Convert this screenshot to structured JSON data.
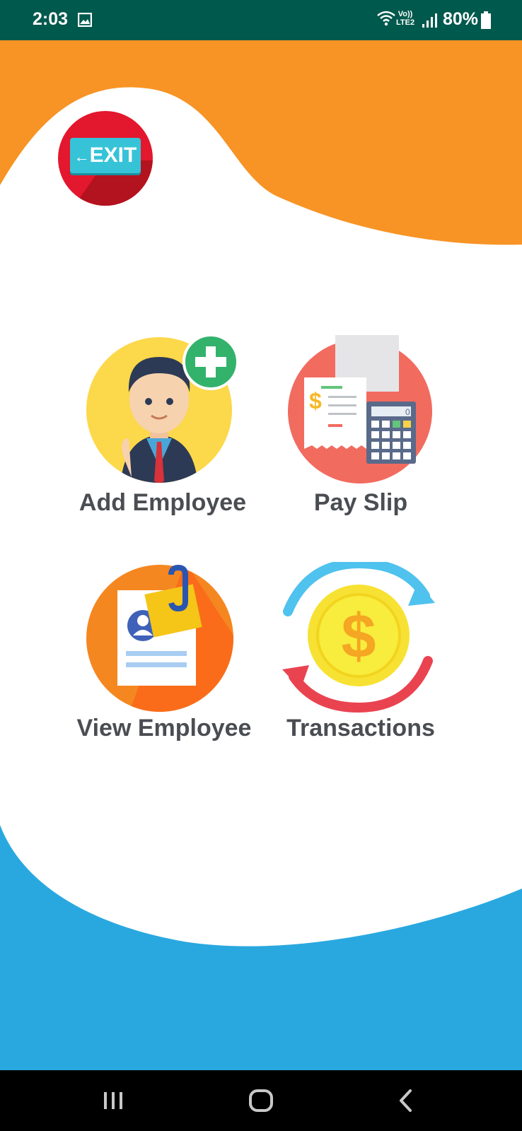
{
  "status_bar": {
    "time": "2:03",
    "network_label_top": "Vo))",
    "network_label_bottom": "LTE2",
    "battery": "80%",
    "icons": [
      "gallery-icon",
      "wifi-icon",
      "signal-icon",
      "battery-icon"
    ]
  },
  "exit": {
    "label": "EXIT"
  },
  "menu": {
    "add_employee": "Add Employee",
    "pay_slip": "Pay Slip",
    "view_employee": "View Employee",
    "transactions": "Transactions"
  },
  "pay_slip_icon": {
    "calc_display": "0",
    "currency_symbol": "$"
  },
  "transactions_icon": {
    "currency_symbol": "$"
  },
  "nav": {
    "icons": [
      "recent-apps-icon",
      "home-icon",
      "back-icon"
    ]
  },
  "colors": {
    "status_bar": "#00594d",
    "top_wave": "#f79425",
    "bottom_wave": "#29a8df",
    "label_text": "#4a4d52"
  }
}
